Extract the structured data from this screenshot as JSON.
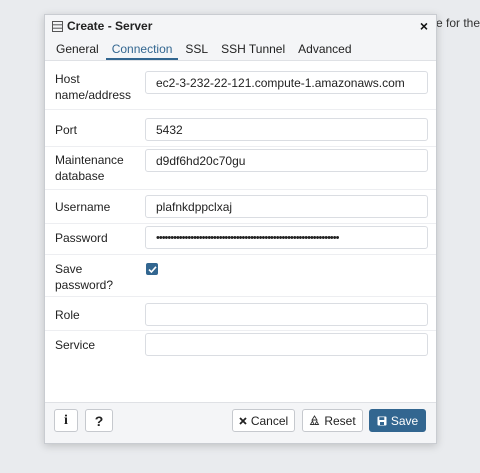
{
  "background": {
    "partial_text": "e for the"
  },
  "dialog": {
    "title": "Create - Server",
    "close_icon": "×"
  },
  "tabs": [
    {
      "label": "General",
      "active": false
    },
    {
      "label": "Connection",
      "active": true
    },
    {
      "label": "SSL",
      "active": false
    },
    {
      "label": "SSH Tunnel",
      "active": false
    },
    {
      "label": "Advanced",
      "active": false
    }
  ],
  "form": {
    "host": {
      "label_line1": "Host",
      "label_line2": "name/address",
      "value": "ec2-3-232-22-121.compute-1.amazonaws.com"
    },
    "port": {
      "label": "Port",
      "value": "5432"
    },
    "maintenance_db": {
      "label_line1": "Maintenance",
      "label_line2": "database",
      "value": "d9df6hd20c70gu"
    },
    "username": {
      "label": "Username",
      "value": "plafnkdppclxaj"
    },
    "password": {
      "label": "Password",
      "value": "••••••••••••••••••••••••••••••••••••••••••••••••••••••••••••••••"
    },
    "save_password": {
      "label_line1": "Save",
      "label_line2": "password?",
      "checked": true
    },
    "role": {
      "label": "Role",
      "value": ""
    },
    "service": {
      "label": "Service",
      "value": ""
    }
  },
  "footer": {
    "info_label": "i",
    "help_label": "?",
    "cancel_label": "Cancel",
    "reset_label": "Reset",
    "save_label": "Save"
  },
  "colors": {
    "accent": "#326690",
    "background": "#e9ebee"
  }
}
